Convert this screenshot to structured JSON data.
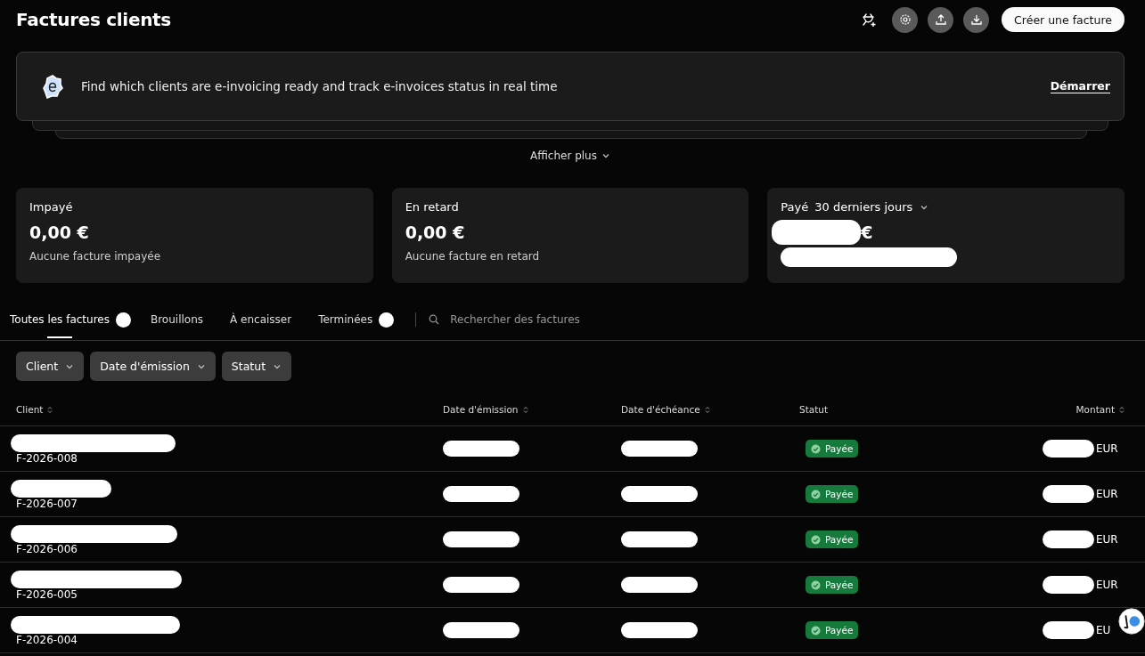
{
  "header": {
    "title": "Factures clients",
    "create_button": "Créer une facture"
  },
  "banner": {
    "text": "Find which clients are e-invoicing ready and track e-invoices status in real time",
    "link": "Démarrer"
  },
  "show_more": "Afficher plus",
  "stats": [
    {
      "label": "Impayé",
      "value": "0,00 €",
      "note": "Aucune facture impayée",
      "redacted": false
    },
    {
      "label": "En retard",
      "value": "0,00 €",
      "note": "Aucune facture en retard",
      "redacted": false
    },
    {
      "label": "Payé",
      "period": "30 derniers jours",
      "value": "€",
      "redacted": true
    }
  ],
  "tabs": [
    {
      "label": "Toutes les factures",
      "selected": true,
      "redacted_badge": true
    },
    {
      "label": "Brouillons",
      "selected": false,
      "redacted_badge": false
    },
    {
      "label": "À encaisser",
      "selected": false,
      "redacted_badge": false
    },
    {
      "label": "Terminées",
      "selected": false,
      "redacted_badge": true
    }
  ],
  "search": {
    "placeholder": "Rechercher des factures"
  },
  "filters": [
    "Client",
    "Date d'émission",
    "Statut"
  ],
  "table": {
    "columns": [
      {
        "label": "Client",
        "sortable": true
      },
      {
        "label": "Date d'émission",
        "sortable": true
      },
      {
        "label": "Date d'échéance",
        "sortable": true
      },
      {
        "label": "Statut",
        "sortable": false
      },
      {
        "label": "Montant",
        "sortable": true
      }
    ],
    "rows": [
      {
        "number": "F-2026-008",
        "status": "Payée",
        "amount": "EUR"
      },
      {
        "number": "F-2026-007",
        "status": "Payée",
        "amount": "EUR"
      },
      {
        "number": "F-2026-006",
        "status": "Payée",
        "amount": "EUR"
      },
      {
        "number": "F-2026-005",
        "status": "Payée",
        "amount": "EUR"
      },
      {
        "number": "F-2026-004",
        "status": "Payée",
        "amount": "EU"
      }
    ]
  }
}
